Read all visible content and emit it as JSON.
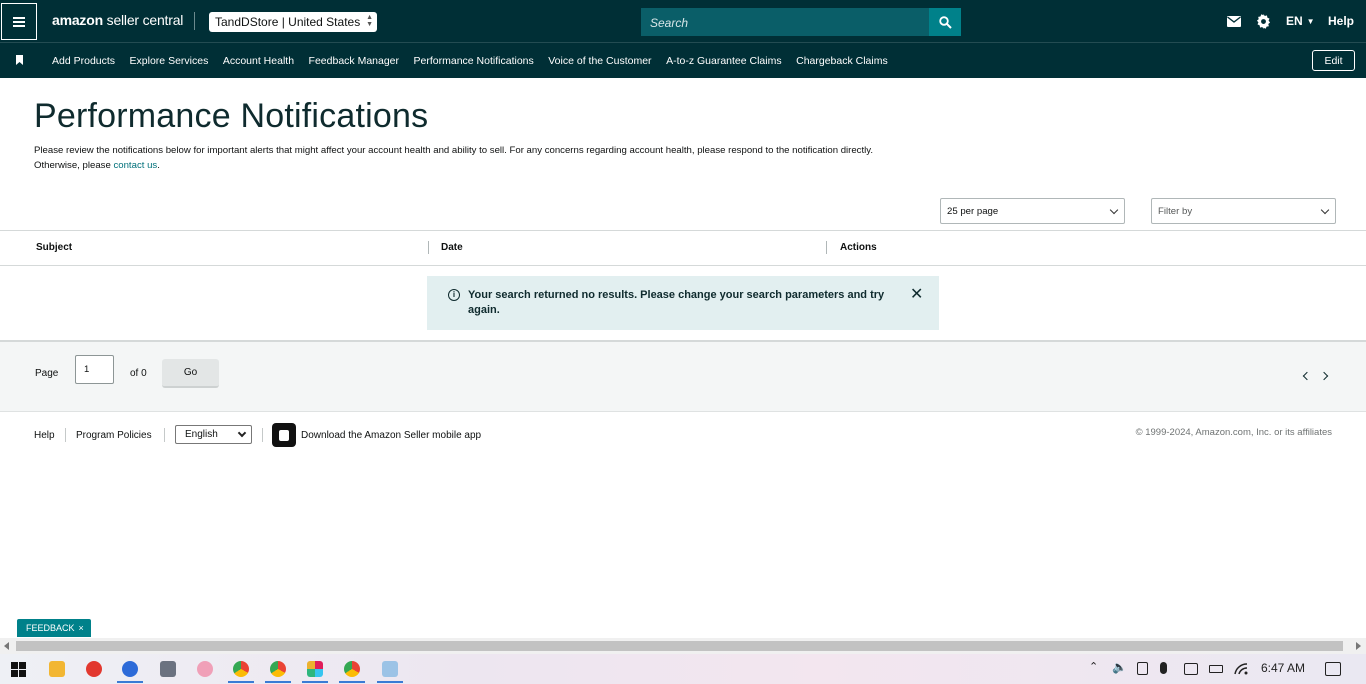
{
  "header": {
    "logo_brand": "amazon",
    "logo_product": "seller central",
    "store_selector": "TandDStore | United States",
    "search_placeholder": "Search",
    "language": "EN",
    "help": "Help"
  },
  "nav": {
    "items": [
      "Add Products",
      "Explore Services",
      "Account Health",
      "Feedback Manager",
      "Performance Notifications",
      "Voice of the Customer",
      "A-to-z Guarantee Claims",
      "Chargeback Claims"
    ],
    "edit_label": "Edit"
  },
  "main": {
    "title": "Performance Notifications",
    "description": "Please review the notifications below for important alerts that might affect your account health and ability to sell. For any concerns regarding account health, please respond to the notification directly. Otherwise, please",
    "contact_link": "contact us",
    "description_end": ".",
    "per_page": "25 per page",
    "filter_placeholder": "Filter by"
  },
  "table": {
    "columns": [
      "Subject",
      "Date",
      "Actions"
    ],
    "empty_message": "Your search returned no results. Please change your search parameters and try again."
  },
  "pagination": {
    "page_label": "Page",
    "page_value": "1",
    "of_label": "of 0",
    "go_label": "Go"
  },
  "footer": {
    "help": "Help",
    "program_policies": "Program Policies",
    "language": "English",
    "download_app": "Download the Amazon Seller mobile app",
    "copyright": "© 1999-2024, Amazon.com, Inc. or its affiliates"
  },
  "feedback_tab": "FEEDBACK",
  "taskbar": {
    "time": "6:47 AM"
  },
  "colors": {
    "header_bg": "#002f36",
    "search_bg": "#0a5e68",
    "accent": "#00818a",
    "alert_bg": "#e2eff0"
  }
}
